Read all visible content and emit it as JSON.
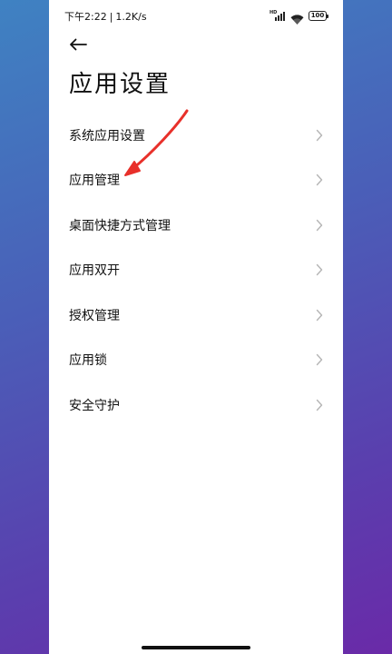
{
  "status_bar": {
    "time": "下午2:22",
    "separator": "|",
    "network_speed": "1.2K/s",
    "signal_label": "HD",
    "battery": "100"
  },
  "header": {
    "title": "应用设置"
  },
  "settings": {
    "items": [
      {
        "label": "系统应用设置"
      },
      {
        "label": "应用管理"
      },
      {
        "label": "桌面快捷方式管理"
      },
      {
        "label": "应用双开"
      },
      {
        "label": "授权管理"
      },
      {
        "label": "应用锁"
      },
      {
        "label": "安全守护"
      }
    ]
  },
  "colors": {
    "annotation_arrow": "#e8302a",
    "text": "#111111",
    "chevron": "#b5b5b5"
  }
}
